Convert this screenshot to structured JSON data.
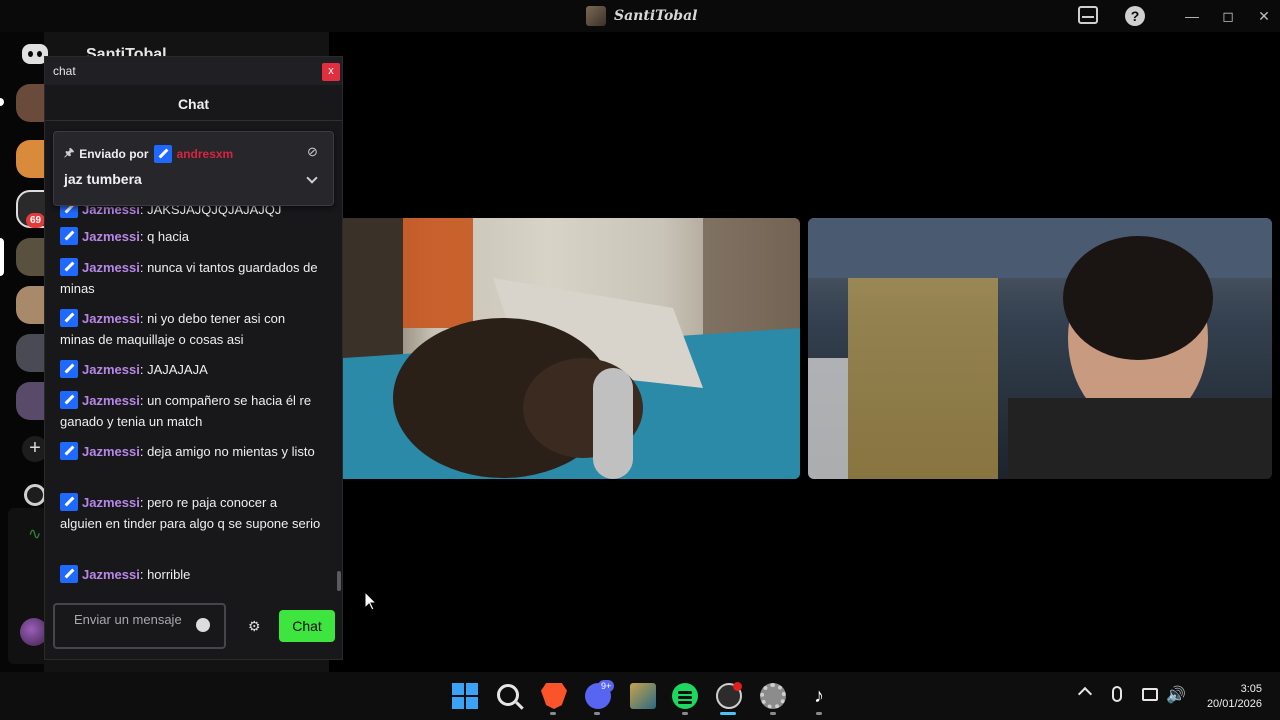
{
  "window": {
    "title": "SantiTobal"
  },
  "rail": {
    "mention_badge": "69"
  },
  "background_panel": {
    "title": "SantiTobal"
  },
  "chat_window": {
    "window_label": "chat",
    "close_label": "x",
    "header_title": "Chat",
    "pinned": {
      "sent_by_label": "Enviado por",
      "user": "andresxm",
      "text": "jaz tumbera"
    },
    "messages": [
      {
        "user": "Jazmessi",
        "text": "JAKSJAJQJQJAJAJQJ"
      },
      {
        "user": "Jazmessi",
        "text": "q hacia"
      },
      {
        "user": "Jazmessi",
        "text": "nunca vi tantos guardados de minas"
      },
      {
        "user": "Jazmessi",
        "text": "ni yo debo tener asi con minas de maquillaje o cosas asi"
      },
      {
        "user": "Jazmessi",
        "text": "JAJAJAJA"
      },
      {
        "user": "Jazmessi",
        "text": "un compañero se hacia él re ganado y tenia un match"
      },
      {
        "user": "Jazmessi",
        "text": "deja amigo no mientas y listo"
      },
      {
        "user": "Jazmessi",
        "text": "pero re paja conocer a alguien en tinder para algo q se supone serio"
      },
      {
        "user": "Jazmessi",
        "text": "horrible"
      }
    ],
    "input_placeholder": "Enviar un mensaje",
    "send_button": "Chat"
  },
  "taskbar": {
    "discord_badge": "9+",
    "time": "3:05",
    "date": "20/01/2026"
  },
  "colors": {
    "accent_green": "#3fe53f",
    "username_purple": "#b787e6",
    "pinned_user_red": "#d9243f",
    "badge_blue": "#1f69ff"
  },
  "icons": [
    "inbox-icon",
    "help-icon",
    "minimize-icon",
    "maximize-icon",
    "close-icon",
    "discord-icon",
    "pin-icon",
    "eye-off-icon",
    "chevron-down-icon",
    "emoji-icon",
    "settings-icon",
    "windows-start-icon",
    "search-icon",
    "brave-icon",
    "discord-icon",
    "league-icon",
    "spotify-icon",
    "obs-icon",
    "settings-app-icon",
    "tiktok-icon",
    "microphone-icon",
    "network-icon",
    "volume-icon"
  ]
}
